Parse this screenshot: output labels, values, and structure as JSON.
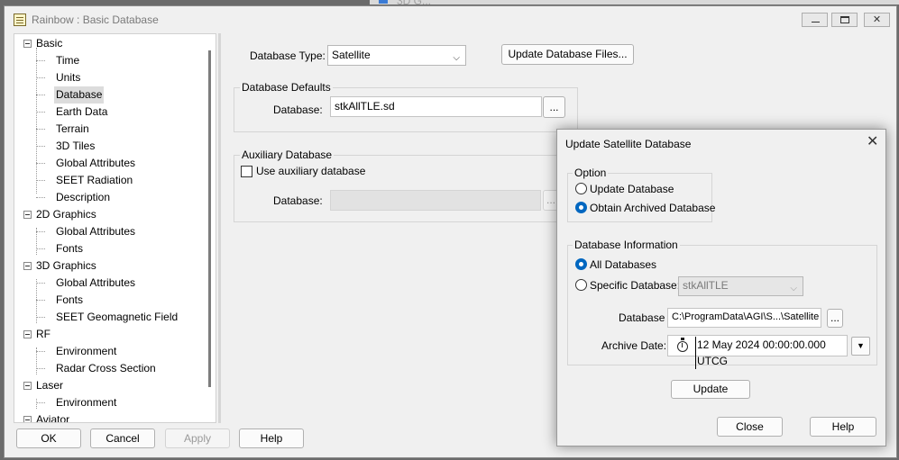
{
  "background": {
    "title": "3D G..."
  },
  "window": {
    "title": "Rainbow : Basic Database"
  },
  "tree": {
    "basic": "Basic",
    "basic_children": [
      "Time",
      "Units",
      "Database",
      "Earth Data",
      "Terrain",
      "3D Tiles",
      "Global Attributes",
      "SEET Radiation",
      "Description"
    ],
    "graphics2d": "2D Graphics",
    "graphics2d_children": [
      "Global Attributes",
      "Fonts"
    ],
    "graphics3d": "3D Graphics",
    "graphics3d_children": [
      "Global Attributes",
      "Fonts",
      "SEET Geomagnetic Field"
    ],
    "rf": "RF",
    "rf_children": [
      "Environment",
      "Radar Cross Section"
    ],
    "laser": "Laser",
    "laser_children": [
      "Environment"
    ],
    "aviator": "Aviator",
    "selected": "Database"
  },
  "main": {
    "database_type_label": "Database Type:",
    "database_type_value": "Satellite",
    "update_files_button": "Update Database Files...",
    "defaults_group": "Database Defaults",
    "database_label": "Database:",
    "database_value": "stkAllTLE.sd",
    "browse_button": "...",
    "aux_group": "Auxiliary Database",
    "use_aux_label": "Use auxiliary database",
    "aux_database_label": "Database:",
    "aux_browse_button": "..."
  },
  "footer": {
    "ok": "OK",
    "cancel": "Cancel",
    "apply": "Apply",
    "help": "Help"
  },
  "dialog": {
    "title": "Update Satellite Database",
    "option_group": "Option",
    "update_database": "Update Database",
    "obtain_archived": "Obtain Archived Database",
    "info_group": "Database Information",
    "all_databases": "All Databases",
    "specific_database": "Specific Database:",
    "specific_value": "stkAllTLE",
    "database_label": "Database",
    "database_path": "C:\\ProgramData\\AGI\\S...\\Satellite",
    "browse_button": "...",
    "archive_date_label": "Archive Date:",
    "archive_date_value": "12 May 2024 00:00:00.000 UTCG",
    "update_button": "Update",
    "close_button": "Close",
    "help_button": "Help"
  },
  "colors": {
    "accent": "#0067c0",
    "window_bg": "#f0f0f0",
    "selection": "#dcdcdc"
  }
}
